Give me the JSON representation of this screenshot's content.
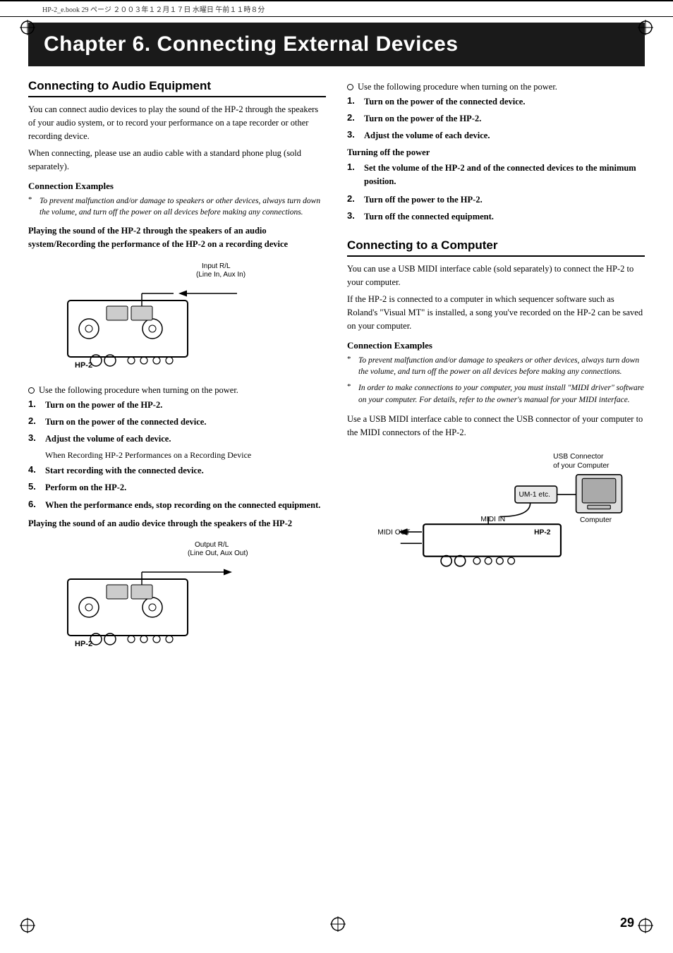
{
  "header": {
    "text": "HP-2_e.book  29 ページ  ２００３年１２月１７日  水曜日  午前１１時８分"
  },
  "chapter": {
    "title": "Chapter 6. Connecting External Devices"
  },
  "left_column": {
    "section1_heading": "Connecting to Audio Equipment",
    "section1_intro1": "You can connect audio devices to play the sound of the HP-2 through the speakers of your audio system, or to record your performance on a tape recorder or other recording device.",
    "section1_intro2": "When connecting, please use an audio cable with a standard phone plug (sold separately).",
    "connection_examples_heading": "Connection Examples",
    "note_italic": "To prevent malfunction and/or damage to speakers or other devices, always turn down the volume, and turn off the power on all devices before making any connections.",
    "bold_heading1": "Playing the sound of the HP-2 through the speakers of an audio system/Recording the performance of the HP-2 on a recording device",
    "diagram1_label_top": "Input R/L",
    "diagram1_label_top2": "(Line In, Aux In)",
    "diagram1_hp2": "HP-2",
    "procedure_intro1": "Use the following procedure when turning on the power.",
    "steps_left": [
      {
        "num": "1.",
        "text": "Turn on the power of the HP-2."
      },
      {
        "num": "2.",
        "text": "Turn on the power of the connected device."
      },
      {
        "num": "3.",
        "text": "Adjust the volume of each device."
      }
    ],
    "sub_note1": "When Recording HP-2 Performances on a Recording Device",
    "steps_left2": [
      {
        "num": "4.",
        "text": "Start recording with the connected device."
      },
      {
        "num": "5.",
        "text": "Perform on the HP-2."
      },
      {
        "num": "6.",
        "text": "When the performance ends, stop recording on the connected equipment."
      }
    ],
    "bold_heading2": "Playing the sound of an audio device through the speakers of the HP-2",
    "diagram2_label_top": "Output  R/L",
    "diagram2_label_top2": "(Line Out, Aux Out)",
    "diagram2_hp2": "HP-2"
  },
  "right_column": {
    "procedure_intro1": "Use the following procedure when turning on the power.",
    "steps_right": [
      {
        "num": "1.",
        "text": "Turn on the power of the connected device."
      },
      {
        "num": "2.",
        "text": "Turn on the power of the HP-2."
      },
      {
        "num": "3.",
        "text": "Adjust the volume of each device."
      }
    ],
    "turning_off_heading": "Turning off the power",
    "steps_right2": [
      {
        "num": "1.",
        "text": "Set the volume of the HP-2 and of the connected devices to the minimum position."
      },
      {
        "num": "2.",
        "text": "Turn off the power to the HP-2."
      },
      {
        "num": "3.",
        "text": "Turn off the connected equipment."
      }
    ],
    "section2_heading": "Connecting to a Computer",
    "section2_intro1": "You can use a USB MIDI interface cable (sold separately) to connect the HP-2 to your computer.",
    "section2_intro2": "If the HP-2 is connected to a computer in which sequencer software such as Roland's \"Visual MT\" is installed, a song you've recorded on the HP-2 can be saved on your computer.",
    "connection_examples_heading": "Connection Examples",
    "note1_italic": "To prevent malfunction and/or damage to speakers or other devices, always turn down the volume, and turn off the power on all devices before making any connections.",
    "note2_italic": "In order to make connections to your computer, you must install \"MIDI driver\" software on your computer. For details, refer to the owner's manual for your MIDI interface.",
    "cable_info": "Use a USB MIDI interface cable to connect the USB connector of your computer to the MIDI connectors of the HP-2.",
    "diagram3_usb_label": "USB Connector",
    "diagram3_usb_label2": "of your Computer",
    "diagram3_um1": "UM-1 etc.",
    "diagram3_computer": "Computer",
    "diagram3_midi_out": "MIDI OUT",
    "diagram3_midi_in": "MIDI IN",
    "diagram3_hp2": "HP-2"
  },
  "page_number": "29"
}
